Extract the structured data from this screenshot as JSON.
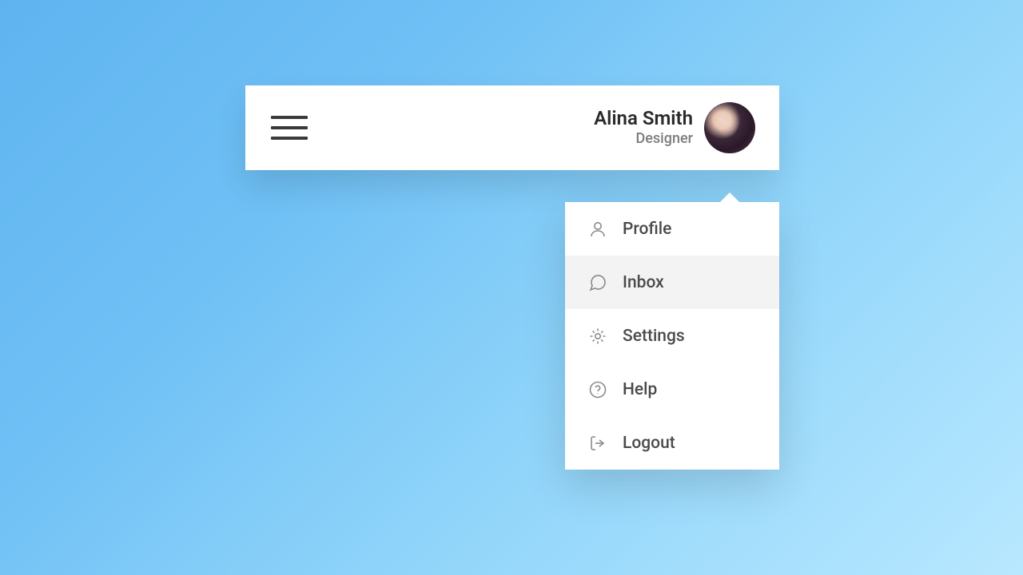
{
  "user": {
    "name": "Alina Smith",
    "role": "Designer"
  },
  "menu": {
    "items": [
      {
        "label": "Profile",
        "icon": "user-icon",
        "hover": false
      },
      {
        "label": "Inbox",
        "icon": "chat-icon",
        "hover": true
      },
      {
        "label": "Settings",
        "icon": "gear-icon",
        "hover": false
      },
      {
        "label": "Help",
        "icon": "question-icon",
        "hover": false
      },
      {
        "label": "Logout",
        "icon": "logout-icon",
        "hover": false
      }
    ]
  }
}
